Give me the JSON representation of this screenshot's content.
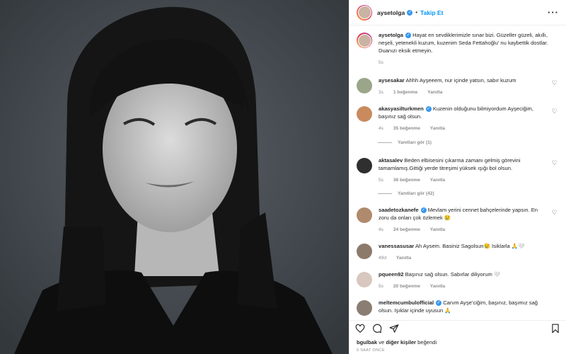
{
  "post": {
    "username": "aysetolga",
    "follow_label": "Takip Et",
    "caption": "Hayat en sevdiklerimizle sınar bizi. Güzeller güzeli, akıllı, neşeli, yetenekli kuzum, kuzenim Seda Fettahoğlu' nu kaybettik dostlar. Duanızı eksik etmeyin.",
    "caption_time": "5s"
  },
  "comments": [
    {
      "username": "aysesakar",
      "verified": false,
      "text": "Ahhh Ayşeeem, nur içinde yatsın, sabır kuzum",
      "time": "3s",
      "likes": "1 beğenme",
      "reply": "Yanıtla",
      "avatar_color": "#9aa58a"
    },
    {
      "username": "akasyasilturkmen",
      "verified": true,
      "text": "Kuzenin olduğunu bilmiyordum Ayşeciğim, başınız sağ olsun.",
      "time": "4s",
      "likes": "35 beğenme",
      "reply": "Yanıtla",
      "avatar_color": "#c98a5e",
      "view_replies": "Yanıtları gör (1)"
    },
    {
      "username": "aktasalev",
      "verified": false,
      "text": "Beden elbisesini çıkarma zamanı gelmiş görevini tamamlamış.Gittiği yerde titreşimi yüksek ışığı bol olsun.",
      "time": "5s",
      "likes": "36 beğenme",
      "reply": "Yanıtla",
      "avatar_color": "#2f2f2f",
      "view_replies": "Yanıtları gör (42)"
    },
    {
      "username": "saadetozkanefe",
      "verified": true,
      "text": "Mevlam yerini cennet bahçelerinde yapsın. En zoru da onları çok özlemek 😢",
      "time": "4s",
      "likes": "24 beğenme",
      "reply": "Yanıtla",
      "avatar_color": "#b08a6d"
    },
    {
      "username": "vanessasusar",
      "verified": false,
      "text": "Ah Aysem. Basiniz Sagolsun😢 Isiklarla 🙏🤍",
      "time": "49d",
      "likes": "",
      "reply": "Yanıtla",
      "avatar_color": "#8c7a6b"
    },
    {
      "username": "pqueen92",
      "verified": false,
      "text": "Başınız sağ olsun. Sabırlar diliyorum 🤍",
      "time": "5s",
      "likes": "20 beğenme",
      "reply": "Yanıtla",
      "avatar_color": "#d8c7bf"
    },
    {
      "username": "meltemcumbulofficial",
      "verified": true,
      "text": "Canım Ayşe'ciğim, başınız, başımız sağ olsun. Işıklar içinde uyusun 🙏",
      "time": "",
      "likes": "",
      "reply": "",
      "avatar_color": "#8a7d72"
    }
  ],
  "footer": {
    "liked_by_user": "bgulbak",
    "liked_by_rest": " ve ",
    "liked_by_others": "diğer kişiler",
    "liked_by_suffix": " beğendi",
    "timestamp": "5 SAAT ÖNCE"
  },
  "icons": [
    "more-options-icon",
    "verified-badge-icon",
    "heart-icon",
    "comment-icon",
    "share-icon",
    "bookmark-icon"
  ],
  "colors": {
    "accent": "#0095f6",
    "verified": "#3897f0",
    "photo_bg": "#3f4449",
    "muted": "#8e8e8e"
  }
}
